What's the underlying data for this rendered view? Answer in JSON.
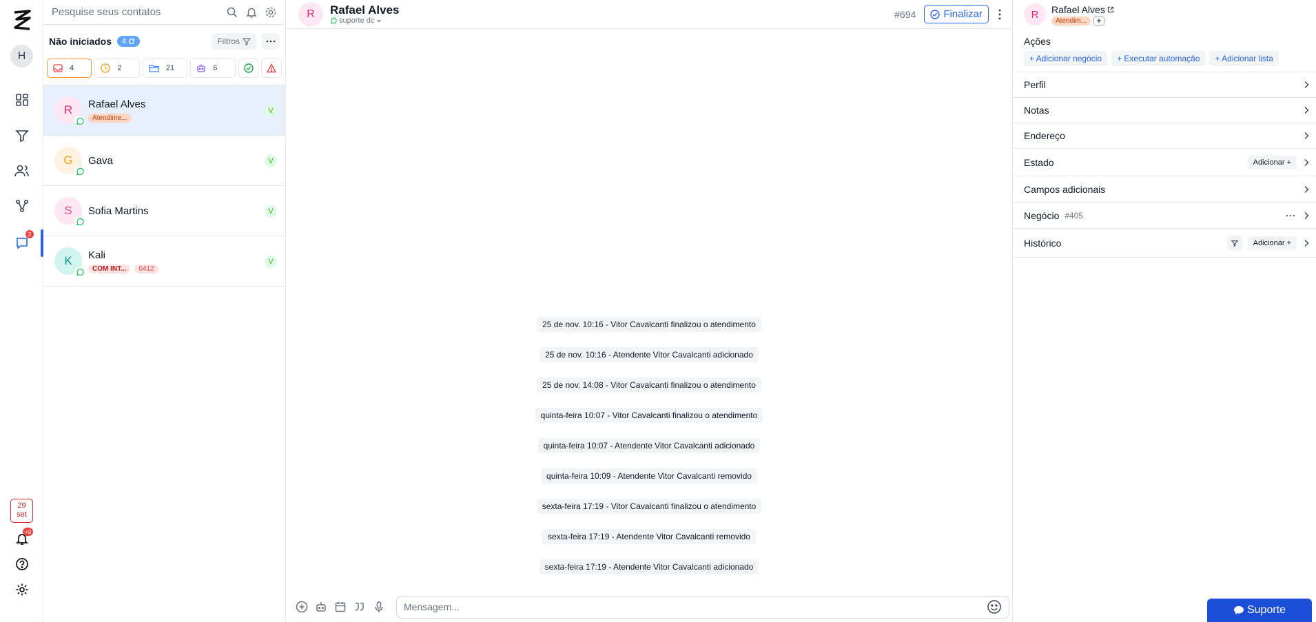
{
  "rail": {
    "avatar_initial": "H",
    "chat_badge": "2",
    "date_day": "29",
    "date_month": "set",
    "notif_badge": "+9"
  },
  "contacts": {
    "search_placeholder": "Pesquise seus contatos",
    "section_title": "Não iniciados",
    "section_count": "4",
    "filters_label": "Filtros",
    "chips": [
      {
        "icon": "inbox-icon",
        "count": "4",
        "color": "#ef4444"
      },
      {
        "icon": "clock-icon",
        "count": "2",
        "color": "#f59e0b"
      },
      {
        "icon": "folder-icon",
        "count": "21",
        "color": "#3b82f6"
      },
      {
        "icon": "bot-icon",
        "count": "6",
        "color": "#8b5cf6"
      }
    ],
    "items": [
      {
        "initial": "R",
        "name": "Rafael Alves",
        "tags": [
          "Atendime..."
        ],
        "badge": "V"
      },
      {
        "initial": "G",
        "name": "Gava",
        "tags": [],
        "badge": "V"
      },
      {
        "initial": "S",
        "name": "Sofia Martins",
        "tags": [],
        "badge": "V"
      },
      {
        "initial": "K",
        "name": "Kali",
        "tags": [
          "COM INT...",
          "0412"
        ],
        "badge": "V"
      }
    ]
  },
  "chat": {
    "avatar_initial": "R",
    "name": "Rafael Alves",
    "channel": "suporte dc",
    "ticket": "#694",
    "finalize_label": "Finalizar",
    "events": [
      "25 de nov. 10:16 - Vitor Cavalcanti finalizou o atendimento",
      "25 de nov. 10:16 - Atendente Vitor Cavalcanti adicionado",
      "25 de nov. 14:08 - Vitor Cavalcanti finalizou o atendimento",
      "quinta-feira 10:07 - Vitor Cavalcanti finalizou o atendimento",
      "quinta-feira 10:07 - Atendente Vitor Cavalcanti adicionado",
      "quinta-feira 10:09 - Atendente Vitor Cavalcanti removido",
      "sexta-feira 17:19 - Vitor Cavalcanti finalizou o atendimento",
      "sexta-feira 17:19 - Atendente Vitor Cavalcanti removido",
      "sexta-feira 17:19 - Atendente Vitor Cavalcanti adicionado"
    ],
    "message_placeholder": "Mensagem..."
  },
  "side": {
    "avatar_initial": "R",
    "name": "Rafael Alves",
    "tag": "Atendim...",
    "actions_title": "Ações",
    "actions": [
      "+ Adicionar negócio",
      "+ Executar automação",
      "+ Adicionar lista"
    ],
    "sections": {
      "perfil": "Perfil",
      "notas": "Notas",
      "endereco": "Endereço",
      "estado": "Estado",
      "estado_add": "Adicionar +",
      "campos": "Campos adicionais",
      "negocio": "Negócio",
      "negocio_id": "#405",
      "historico": "Histórico",
      "historico_add": "Adicionar +"
    }
  },
  "support_button": "Suporte",
  "colors": {
    "accent": "#2563eb",
    "selected_row": "#e8effc",
    "whatsapp": "#22c55e",
    "alert": "#ef4444"
  }
}
